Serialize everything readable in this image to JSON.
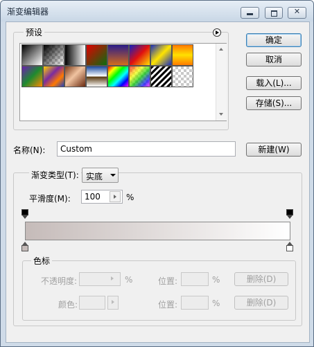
{
  "window": {
    "title": "渐变编辑器"
  },
  "presets": {
    "label": "预设",
    "swatches": [
      {
        "name": "black-white",
        "bg": "linear-gradient(135deg,#000 0%,#fff 100%)"
      },
      {
        "name": "black-transparent",
        "bg": "linear-gradient(135deg,#000 0%,rgba(0,0,0,0) 100%)"
      },
      {
        "name": "black-to-white-hard",
        "bg": "linear-gradient(90deg,#000 0%,#fff 100%)"
      },
      {
        "name": "red-green",
        "bg": "linear-gradient(135deg,#e10000 0%,#0a6d10 100%)"
      },
      {
        "name": "violet-orange",
        "bg": "linear-gradient(180deg,#2b1d8a 0%,#d26b1c 100%)"
      },
      {
        "name": "blue-red-yellow",
        "bg": "linear-gradient(135deg,#1020c0 0%,#e01010 50%,#ffe000 100%)"
      },
      {
        "name": "blue-yellow-blue",
        "bg": "linear-gradient(135deg,#1a2fbf 0%,#ffe400 50%,#1a2fbf 100%)"
      },
      {
        "name": "orange-yellow-orange",
        "bg": "linear-gradient(180deg,#ff7a00 0%,#ffe000 50%,#ff7a00 100%)"
      },
      {
        "name": "violet-green-orange",
        "bg": "linear-gradient(135deg,#6a1fb0 0%,#1e8a2f 50%,#ff8a00 100%)"
      },
      {
        "name": "yellow-violet-orange-blue",
        "bg": "linear-gradient(135deg,#ffd200 0%,#7a2ba0 40%,#ff7a00 70%,#2040c0 100%)"
      },
      {
        "name": "copper",
        "bg": "linear-gradient(135deg,#7a3a18 0%,#f0c3a0 45%,#6a2a10 100%)"
      },
      {
        "name": "chrome",
        "bg": "linear-gradient(180deg,#1a4aa0 0%,#fff 48%,#5a3a10 52%,#fff 100%)"
      },
      {
        "name": "spectrum",
        "bg": "linear-gradient(135deg,#ff0000,#ff0 20%,#0f0 40%,#0ff 60%,#00f 80%,#f0f)"
      },
      {
        "name": "transparent-rainbow",
        "bg": "linear-gradient(135deg,rgba(255,0,0,.7),rgba(255,255,0,.7) 30%,rgba(0,200,0,.7) 55%,rgba(0,0,255,.7) 80%,rgba(255,0,255,.7))"
      },
      {
        "name": "transparent-stripes",
        "bg": "repeating-linear-gradient(135deg,#000 0 3px,#fff 3px 6px)"
      },
      {
        "name": "transparent-checker",
        "bg": "repeating-conic-gradient(#c8c8c8 0 25%,#fff 0 50%) 0 0/8px 8px"
      }
    ]
  },
  "buttons": {
    "ok": "确定",
    "cancel": "取消",
    "load": "载入(L)...",
    "save": "存储(S)...",
    "new": "新建(W)"
  },
  "name_field": {
    "label": "名称(N):",
    "value": "Custom"
  },
  "gradient": {
    "type_label": "渐变类型(T):",
    "type_value": "实底",
    "smoothness_label": "平滑度(M):",
    "smoothness_value": "100",
    "smoothness_unit": "%",
    "start_color": "#c5bbb9",
    "end_color": "#ffffff"
  },
  "stops": {
    "label": "色标",
    "opacity_label": "不透明度:",
    "opacity_unit": "%",
    "location_label_1": "位置:",
    "location_unit_1": "%",
    "delete_label_1": "删除(D)",
    "color_label": "颜色:",
    "location_label_2": "位置:",
    "location_unit_2": "%",
    "delete_label_2": "删除(D)"
  }
}
